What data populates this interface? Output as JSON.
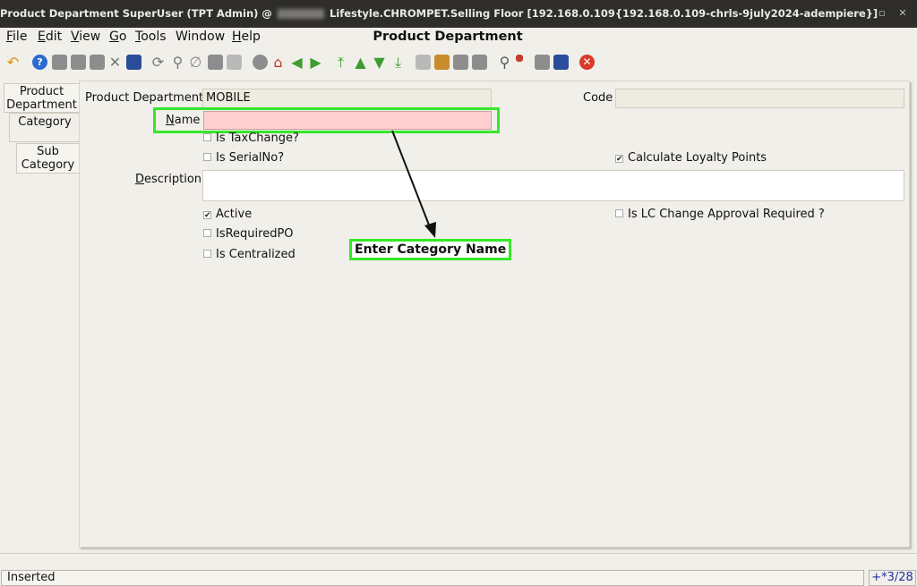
{
  "titlebar": {
    "title_pre": "Product Department  SuperUser (TPT Admin) @",
    "title_post": "Lifestyle.CHROMPET.Selling Floor [192.168.0.109{192.168.0.109-chrls-9july2024-adempiere}]",
    "minimize": "–",
    "maximize": "▫",
    "close": "✕"
  },
  "menu": {
    "items": [
      {
        "u": "F",
        "rest": "ile"
      },
      {
        "u": "E",
        "rest": "dit"
      },
      {
        "u": "V",
        "rest": "iew"
      },
      {
        "u": "G",
        "rest": "o"
      },
      {
        "u": "T",
        "rest": "ools"
      },
      {
        "u": "",
        "rest": "Window"
      },
      {
        "u": "H",
        "rest": "elp"
      }
    ],
    "window_title": "Product Department"
  },
  "tabs": {
    "product_department": "Product Department",
    "category": "Category",
    "sub_category": "Sub Category"
  },
  "form": {
    "product_department_label": "Product Department",
    "product_department_value": "MOBILE",
    "code_label": "Code",
    "code_value": "",
    "name_label_u": "N",
    "name_label_rest": "ame",
    "name_value": "",
    "description_label_u": "D",
    "description_label_rest": "escription",
    "description_value": "",
    "is_tax_change": {
      "label": "Is TaxChange?",
      "checked": false
    },
    "is_serial_no": {
      "label": "Is SerialNo?",
      "checked": false
    },
    "calculate_loyalty_points": {
      "label": "Calculate Loyalty Points",
      "checked": true
    },
    "active": {
      "label": "Active",
      "checked": true
    },
    "is_lc_change": {
      "label": "Is LC Change Approval Required ?",
      "checked": false
    },
    "is_required_po": {
      "label": "IsRequiredPO",
      "checked": false
    },
    "is_centralized": {
      "label": "Is Centralized",
      "checked": false
    }
  },
  "annotation": {
    "callout_text": "Enter Category Name",
    "highlight_color": "#35e82a"
  },
  "status": {
    "message": "Inserted",
    "record_info": "+*3/28"
  },
  "colors": {
    "mandatory_field": "#ffcfcf",
    "readonly_field": "#eeebe0",
    "record_info_text": "#2330a6"
  }
}
